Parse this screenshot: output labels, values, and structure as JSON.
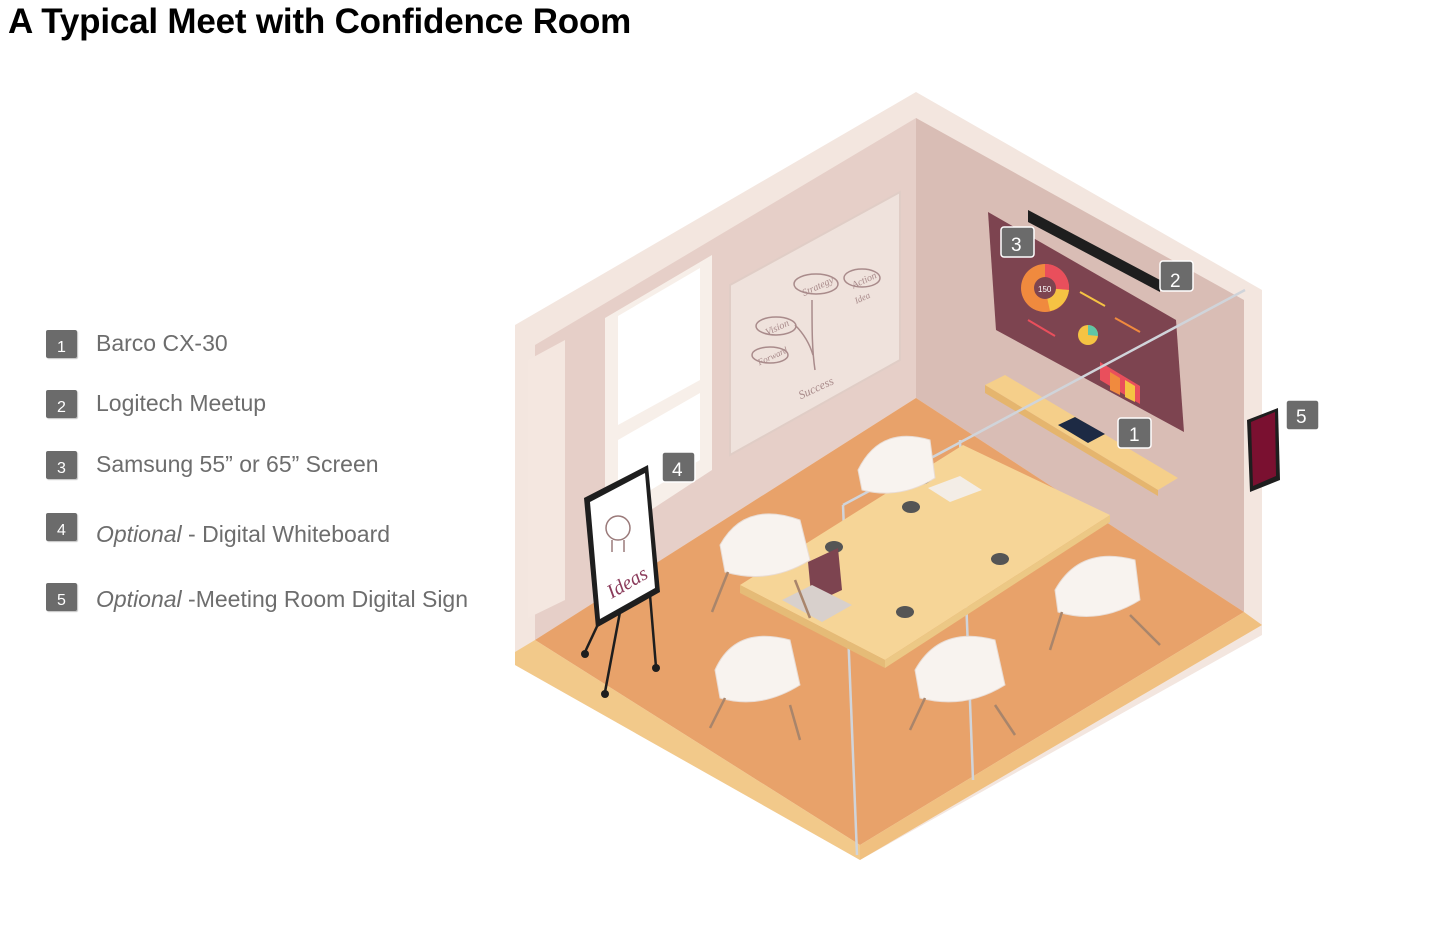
{
  "title": "A Typical Meet with Confidence Room",
  "legend": [
    {
      "number": "1",
      "optional": "",
      "text": "Barco CX-30"
    },
    {
      "number": "2",
      "optional": "",
      "text": "Logitech Meetup"
    },
    {
      "number": "3",
      "optional": "",
      "text": "Samsung 55” or 65” Screen"
    },
    {
      "number": "4",
      "optional": "Optional",
      "text": " - Digital Whiteboard"
    },
    {
      "number": "5",
      "optional": "Optional",
      "text": " -Meeting Room Digital Sign"
    }
  ],
  "callouts": {
    "c1": "1",
    "c2": "2",
    "c3": "3",
    "c4": "4",
    "c5": "5"
  },
  "whiteboard_words": {
    "strategy": "Strategy",
    "vision": "Vision",
    "forward": "Forward",
    "action": "Action",
    "idea": "Idea",
    "success": "Success",
    "ideas": "Ideas"
  },
  "screen_number": "150",
  "colors": {
    "wall_left": "#e9d3cd",
    "wall_right": "#dcc2bb",
    "floor": "#e9a56d",
    "table": "#f7d79a",
    "badge": "#6b6b6b",
    "sign": "#7a1030"
  }
}
